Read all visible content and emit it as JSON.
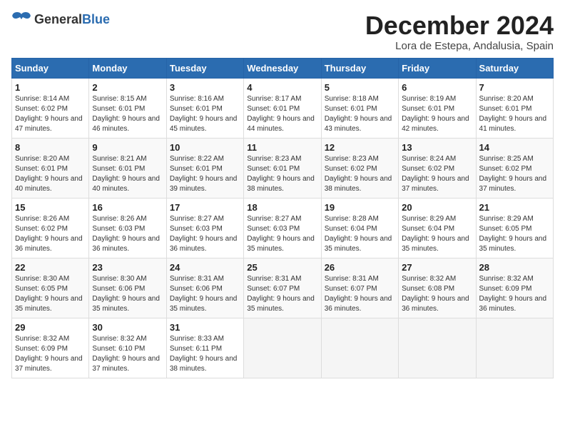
{
  "logo": {
    "general": "General",
    "blue": "Blue"
  },
  "title": "December 2024",
  "location": "Lora de Estepa, Andalusia, Spain",
  "headers": [
    "Sunday",
    "Monday",
    "Tuesday",
    "Wednesday",
    "Thursday",
    "Friday",
    "Saturday"
  ],
  "weeks": [
    [
      {
        "day": "1",
        "sunrise": "8:14 AM",
        "sunset": "6:02 PM",
        "daylight": "9 hours and 47 minutes."
      },
      {
        "day": "2",
        "sunrise": "8:15 AM",
        "sunset": "6:01 PM",
        "daylight": "9 hours and 46 minutes."
      },
      {
        "day": "3",
        "sunrise": "8:16 AM",
        "sunset": "6:01 PM",
        "daylight": "9 hours and 45 minutes."
      },
      {
        "day": "4",
        "sunrise": "8:17 AM",
        "sunset": "6:01 PM",
        "daylight": "9 hours and 44 minutes."
      },
      {
        "day": "5",
        "sunrise": "8:18 AM",
        "sunset": "6:01 PM",
        "daylight": "9 hours and 43 minutes."
      },
      {
        "day": "6",
        "sunrise": "8:19 AM",
        "sunset": "6:01 PM",
        "daylight": "9 hours and 42 minutes."
      },
      {
        "day": "7",
        "sunrise": "8:20 AM",
        "sunset": "6:01 PM",
        "daylight": "9 hours and 41 minutes."
      }
    ],
    [
      {
        "day": "8",
        "sunrise": "8:20 AM",
        "sunset": "6:01 PM",
        "daylight": "9 hours and 40 minutes."
      },
      {
        "day": "9",
        "sunrise": "8:21 AM",
        "sunset": "6:01 PM",
        "daylight": "9 hours and 40 minutes."
      },
      {
        "day": "10",
        "sunrise": "8:22 AM",
        "sunset": "6:01 PM",
        "daylight": "9 hours and 39 minutes."
      },
      {
        "day": "11",
        "sunrise": "8:23 AM",
        "sunset": "6:01 PM",
        "daylight": "9 hours and 38 minutes."
      },
      {
        "day": "12",
        "sunrise": "8:23 AM",
        "sunset": "6:02 PM",
        "daylight": "9 hours and 38 minutes."
      },
      {
        "day": "13",
        "sunrise": "8:24 AM",
        "sunset": "6:02 PM",
        "daylight": "9 hours and 37 minutes."
      },
      {
        "day": "14",
        "sunrise": "8:25 AM",
        "sunset": "6:02 PM",
        "daylight": "9 hours and 37 minutes."
      }
    ],
    [
      {
        "day": "15",
        "sunrise": "8:26 AM",
        "sunset": "6:02 PM",
        "daylight": "9 hours and 36 minutes."
      },
      {
        "day": "16",
        "sunrise": "8:26 AM",
        "sunset": "6:03 PM",
        "daylight": "9 hours and 36 minutes."
      },
      {
        "day": "17",
        "sunrise": "8:27 AM",
        "sunset": "6:03 PM",
        "daylight": "9 hours and 36 minutes."
      },
      {
        "day": "18",
        "sunrise": "8:27 AM",
        "sunset": "6:03 PM",
        "daylight": "9 hours and 35 minutes."
      },
      {
        "day": "19",
        "sunrise": "8:28 AM",
        "sunset": "6:04 PM",
        "daylight": "9 hours and 35 minutes."
      },
      {
        "day": "20",
        "sunrise": "8:29 AM",
        "sunset": "6:04 PM",
        "daylight": "9 hours and 35 minutes."
      },
      {
        "day": "21",
        "sunrise": "8:29 AM",
        "sunset": "6:05 PM",
        "daylight": "9 hours and 35 minutes."
      }
    ],
    [
      {
        "day": "22",
        "sunrise": "8:30 AM",
        "sunset": "6:05 PM",
        "daylight": "9 hours and 35 minutes."
      },
      {
        "day": "23",
        "sunrise": "8:30 AM",
        "sunset": "6:06 PM",
        "daylight": "9 hours and 35 minutes."
      },
      {
        "day": "24",
        "sunrise": "8:31 AM",
        "sunset": "6:06 PM",
        "daylight": "9 hours and 35 minutes."
      },
      {
        "day": "25",
        "sunrise": "8:31 AM",
        "sunset": "6:07 PM",
        "daylight": "9 hours and 35 minutes."
      },
      {
        "day": "26",
        "sunrise": "8:31 AM",
        "sunset": "6:07 PM",
        "daylight": "9 hours and 36 minutes."
      },
      {
        "day": "27",
        "sunrise": "8:32 AM",
        "sunset": "6:08 PM",
        "daylight": "9 hours and 36 minutes."
      },
      {
        "day": "28",
        "sunrise": "8:32 AM",
        "sunset": "6:09 PM",
        "daylight": "9 hours and 36 minutes."
      }
    ],
    [
      {
        "day": "29",
        "sunrise": "8:32 AM",
        "sunset": "6:09 PM",
        "daylight": "9 hours and 37 minutes."
      },
      {
        "day": "30",
        "sunrise": "8:32 AM",
        "sunset": "6:10 PM",
        "daylight": "9 hours and 37 minutes."
      },
      {
        "day": "31",
        "sunrise": "8:33 AM",
        "sunset": "6:11 PM",
        "daylight": "9 hours and 38 minutes."
      },
      null,
      null,
      null,
      null
    ]
  ]
}
